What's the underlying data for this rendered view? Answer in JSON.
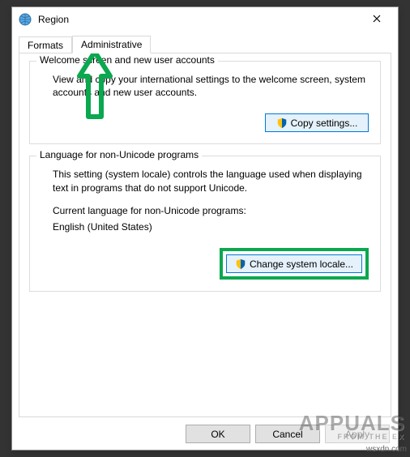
{
  "window": {
    "title": "Region"
  },
  "tabs": {
    "formats": "Formats",
    "administrative": "Administrative"
  },
  "group1": {
    "title": "Welcome screen and new user accounts",
    "body": "View and copy your international settings to the welcome screen, system accounts and new user accounts.",
    "button": "Copy settings..."
  },
  "group2": {
    "title": "Language for non-Unicode programs",
    "body": "This setting (system locale) controls the language used when displaying text in programs that do not support Unicode.",
    "currentLabel": "Current language for non-Unicode programs:",
    "currentValue": "English (United States)",
    "button": "Change system locale..."
  },
  "footer": {
    "ok": "OK",
    "cancel": "Cancel",
    "apply": "Apply"
  },
  "watermark": {
    "main": "APPUALS",
    "sub": "FROM THE EX",
    "source": "wsxdn.com"
  }
}
